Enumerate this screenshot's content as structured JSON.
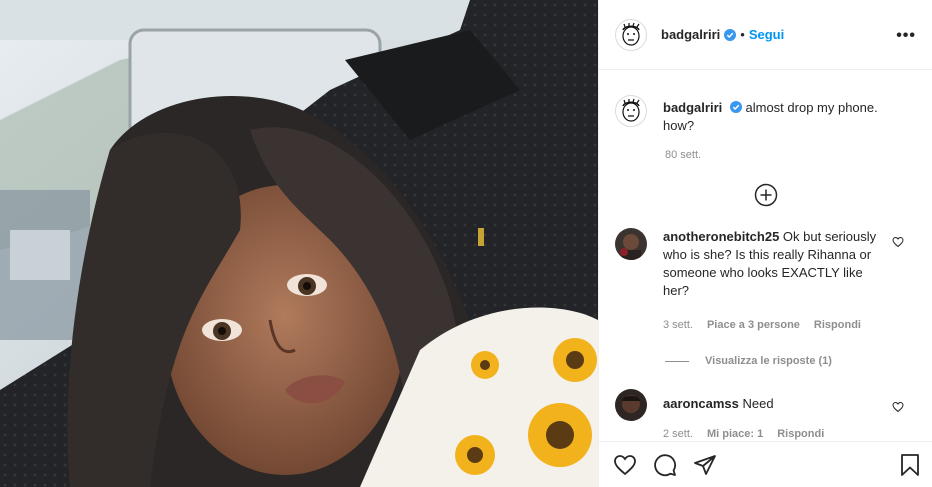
{
  "post": {
    "author": "badgalriri",
    "dot": "•",
    "follow_label": "Segui",
    "more_label": "•••",
    "caption_text": "almost drop my phone. how?",
    "caption_time": "80 sett.",
    "load_more_icon": "plus-circle-icon"
  },
  "comments": [
    {
      "username": "anotheronebitch25",
      "text": "Ok but seriously who is she? Is this really Rihanna or someone who looks EXACTLY like her?",
      "time": "3 sett.",
      "likes": "Piace a 3 persone",
      "reply": "Rispondi",
      "view_replies": "Visualizza le risposte (1)"
    },
    {
      "username": "aaroncamss",
      "text": "Need",
      "time": "2 sett.",
      "likes": "Mi piace: 1",
      "reply": "Rispondi"
    }
  ],
  "actions": {
    "icons": [
      "heart-icon",
      "comment-icon",
      "share-icon",
      "bookmark-icon"
    ]
  },
  "colors": {
    "accent": "#0095f6",
    "verified": "#3897f0",
    "text": "#262626",
    "muted": "#8e8e8e"
  }
}
